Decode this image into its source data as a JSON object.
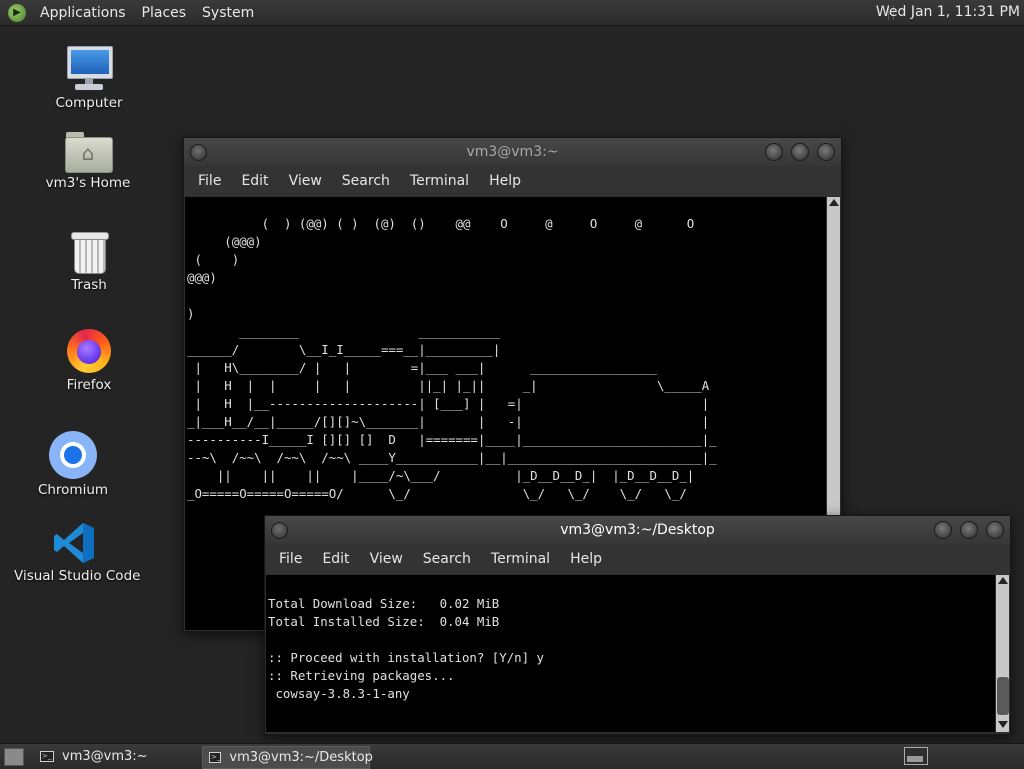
{
  "top_panel": {
    "applications": "Applications",
    "places": "Places",
    "system": "System",
    "clock": "Wed Jan  1, 11:31 PM"
  },
  "desktop_icons": {
    "computer": "Computer",
    "home": "vm3's Home",
    "trash": "Trash",
    "firefox": "Firefox",
    "chromium": "Chromium",
    "vscode": "Visual Studio Code"
  },
  "back_window": {
    "title": "vm3@vm3:~",
    "menu": [
      "File",
      "Edit",
      "View",
      "Search",
      "Terminal",
      "Help"
    ],
    "content": "          (  ) (@@) ( )  (@)  ()    @@    O     @     O     @      O\n     (@@@)\n (    )\n@@@)\n\n)\n       ________                ___________\n______/        \\__I_I_____===__|_________|\n |   H\\________/ |   |        =|___ ___|      _________________\n |   H  |  |     |   |         ||_| |_||     _|                \\_____A\n |   H  |__--------------------| [___] |   =|                        |\n_|___H__/__|_____/[][]~\\_______|       |   -|                        |\n----------I_____I [][] []  D   |=======|____|________________________|_\n--~\\  /~~\\  /~~\\  /~~\\ ____Y___________|__|__________________________|_\n    ||    ||    ||    |____/~\\___/          |_D__D__D_|  |_D__D__D_|\n_O=====O=====O=====O/      \\_/               \\_/   \\_/    \\_/   \\_/"
  },
  "front_window": {
    "title": "vm3@vm3:~/Desktop",
    "menu": [
      "File",
      "Edit",
      "View",
      "Search",
      "Terminal",
      "Help"
    ],
    "content": "\nTotal Download Size:   0.02 MiB\nTotal Installed Size:  0.04 MiB\n\n:: Proceed with installation? [Y/n] y\n:: Retrieving packages...\n cowsay-3.8.3-1-any"
  },
  "taskbar": {
    "tasks": [
      {
        "label": "vm3@vm3:~",
        "active": false
      },
      {
        "label": "vm3@vm3:~/Desktop",
        "active": true
      }
    ]
  },
  "colors": {
    "desktop_bg": "#242424",
    "terminal_bg": "#000000",
    "terminal_fg": "#e0e0e0",
    "panel_bg": "#333333"
  }
}
